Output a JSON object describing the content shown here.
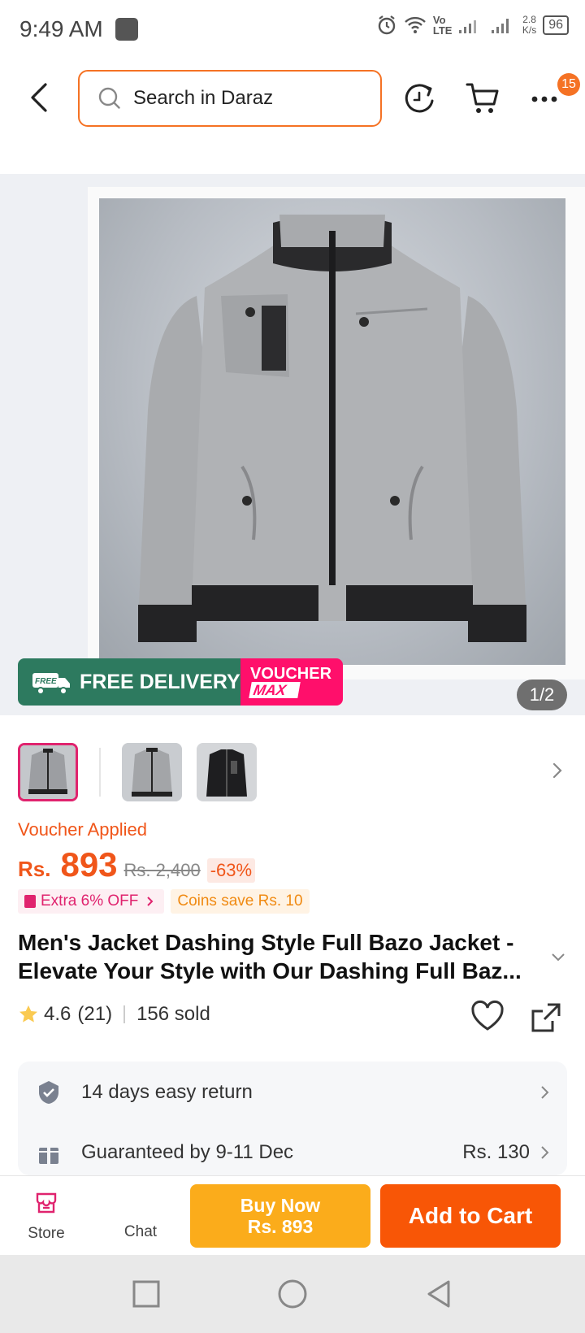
{
  "status_bar": {
    "time": "9:49 AM",
    "net_type": "Vo LTE",
    "speed_value": "2.8",
    "speed_unit": "K/s",
    "battery": "96"
  },
  "header": {
    "search_placeholder": "Search in Daraz",
    "cart_badge": "15",
    "accent_color": "#f57224"
  },
  "gallery": {
    "page_indicator": "1/2",
    "delivery_label": "FREE DELIVERY",
    "delivery_tag": "FREE",
    "voucher_line1": "VOUCHER",
    "voucher_line2": "MAX"
  },
  "thumbnails": [
    {
      "name": "grey-jacket-front",
      "selected": true
    },
    {
      "name": "grey-jacket-alt",
      "selected": false
    },
    {
      "name": "black-jacket",
      "selected": false
    }
  ],
  "pricing": {
    "voucher_applied": "Voucher Applied",
    "currency": "Rs.",
    "price": "893",
    "original_price": "Rs. 2,400",
    "discount": "-63%",
    "extra_off": "Extra 6% OFF",
    "coins_save": "Coins save Rs. 10"
  },
  "product": {
    "title_line1": "Men's Jacket Dashing Style Full Bazo Jacket -",
    "title_line2": "Elevate Your Style with Our Dashing Full Baz...",
    "rating": "4.6",
    "reviews": "(21)",
    "sold": "156 sold"
  },
  "services": [
    {
      "label": "14 days easy return",
      "value": "",
      "icon": "shield-check-icon"
    },
    {
      "label": "Guaranteed by 9-11 Dec",
      "value": "Rs. 130",
      "icon": "gift-box-icon"
    }
  ],
  "actions": {
    "store_label": "Store",
    "chat_label": "Chat",
    "buy_now_label": "Buy Now",
    "buy_now_price": "Rs. 893",
    "add_to_cart_label": "Add to Cart",
    "buy_color": "#fbac1b",
    "cart_color": "#f85606"
  }
}
